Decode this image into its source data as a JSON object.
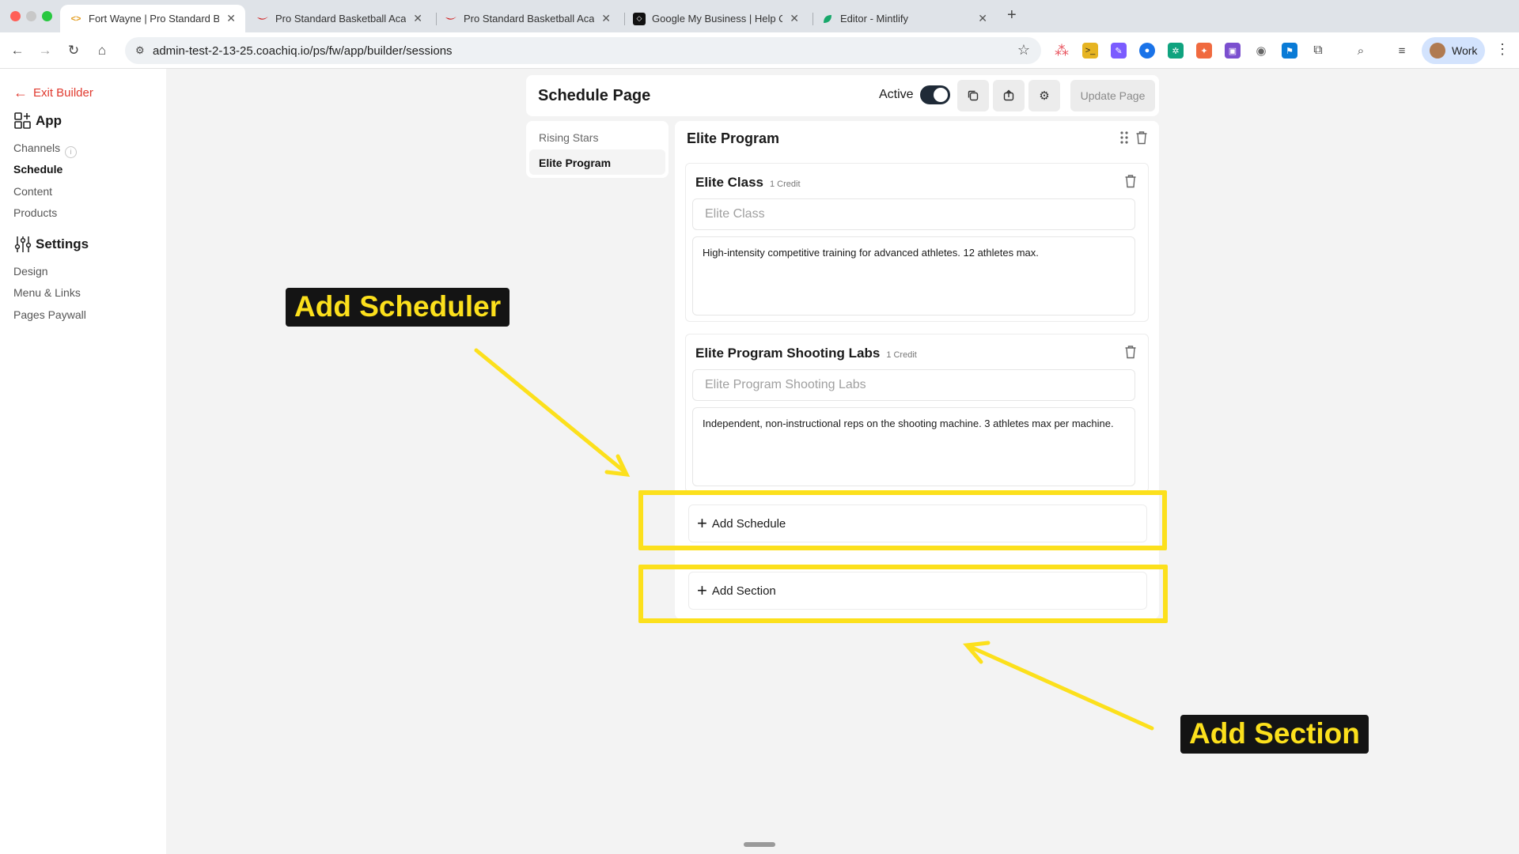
{
  "browser": {
    "tabs": [
      {
        "title": "Fort Wayne | Pro Standard Ba",
        "favicon": "code-brackets-icon"
      },
      {
        "title": "Pro Standard Basketball Acad",
        "favicon": "swoosh-icon"
      },
      {
        "title": "Pro Standard Basketball Acad",
        "favicon": "swoosh-icon"
      },
      {
        "title": "Google My Business | Help Ce",
        "favicon": "diamond-icon"
      },
      {
        "title": "Editor - Mintlify",
        "favicon": "leaf-icon"
      }
    ],
    "url": "admin-test-2-13-25.coachiq.io/ps/fw/app/builder/sessions",
    "profile_label": "Work"
  },
  "sidebar": {
    "exit_label": "Exit Builder",
    "app_heading": "App",
    "app_items": [
      {
        "label": "Channels"
      },
      {
        "label": "Schedule"
      },
      {
        "label": "Content"
      },
      {
        "label": "Products"
      }
    ],
    "settings_heading": "Settings",
    "settings_items": [
      {
        "label": "Design"
      },
      {
        "label": "Menu & Links"
      },
      {
        "label": "Pages Paywall"
      }
    ]
  },
  "header": {
    "title": "Schedule Page",
    "active_label": "Active",
    "active_on": true,
    "update_label": "Update Page"
  },
  "sections_list": [
    {
      "label": "Rising Stars"
    },
    {
      "label": "Elite Program"
    }
  ],
  "section": {
    "title": "Elite Program",
    "classes": [
      {
        "name": "Elite Class",
        "credit": "1 Credit",
        "input_value": "Elite Class",
        "description": "High-intensity competitive training for advanced athletes. 12 athletes max."
      },
      {
        "name": "Elite Program Shooting Labs",
        "credit": "1 Credit",
        "input_value": "Elite Program Shooting Labs",
        "description": "Independent, non-instructional reps on the shooting machine. 3 athletes max per machine."
      }
    ]
  },
  "actions": {
    "add_schedule_label": "Add Schedule",
    "add_section_label": "Add Section"
  },
  "annotations": {
    "scheduler_label": "Add Scheduler",
    "section_label": "Add Section",
    "highlight_color": "#fce01c"
  },
  "colors": {
    "exit_red": "#e03a2f",
    "toggle_dark": "#1f2a37"
  }
}
